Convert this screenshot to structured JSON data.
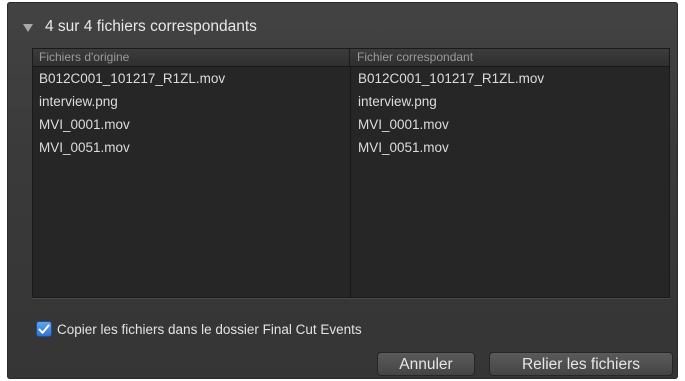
{
  "header": {
    "summary": "4 sur 4 fichiers correspondants"
  },
  "table": {
    "columns": [
      "Fichiers d'origine",
      "Fichier correspondant"
    ],
    "rows": [
      [
        "B012C001_101217_R1ZL.mov",
        "B012C001_101217_R1ZL.mov"
      ],
      [
        "interview.png",
        "interview.png"
      ],
      [
        "MVI_0001.mov",
        "MVI_0001.mov"
      ],
      [
        "MVI_0051.mov",
        "MVI_0051.mov"
      ]
    ]
  },
  "options": {
    "copy_files_label": "Copier les fichiers dans le dossier Final Cut Events",
    "copy_files_checked": true
  },
  "buttons": {
    "cancel_label": "Annuler",
    "relink_label": "Relier les fichiers"
  },
  "colors": {
    "checkbox_accent": "#2f73d0"
  }
}
